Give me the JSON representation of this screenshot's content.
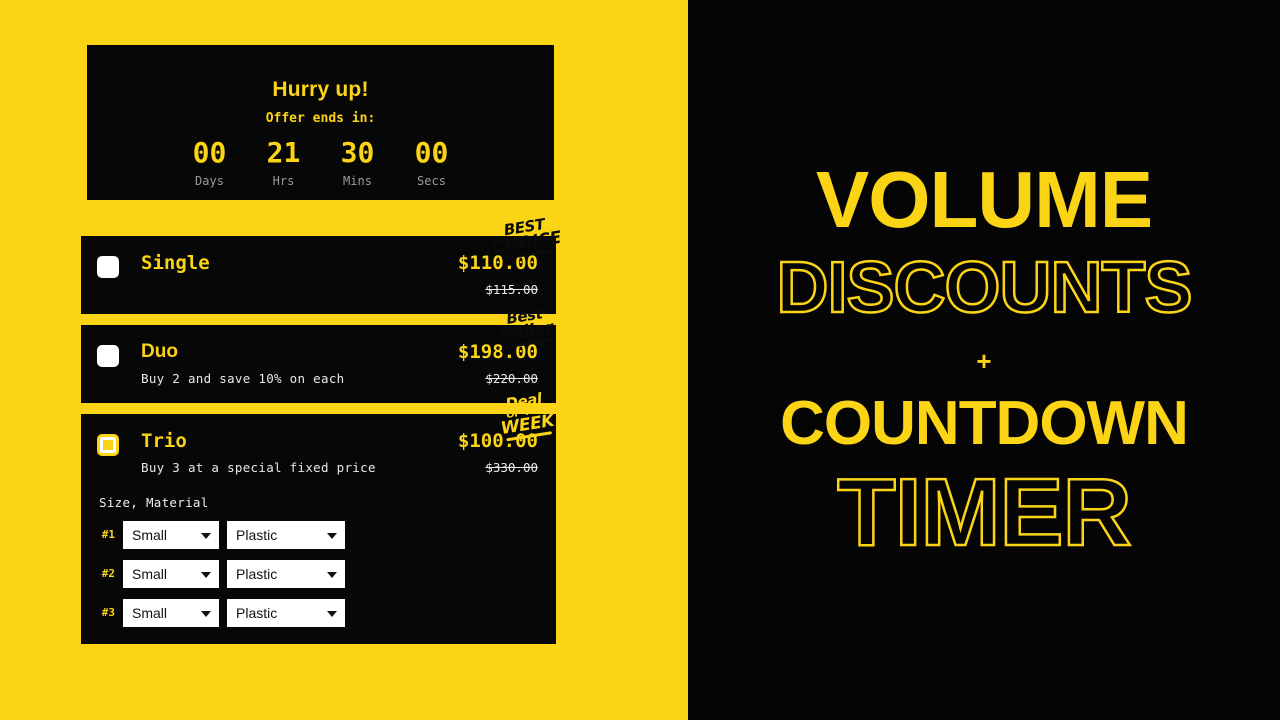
{
  "theme": {
    "yellow": "#FBD415",
    "black": "#070707",
    "white": "#FFFFFF",
    "muted_label": "#9A9A9A"
  },
  "timer": {
    "headline": "Hurry up!",
    "subtitle": "Offer ends in:",
    "units": [
      {
        "value": "00",
        "label": "Days"
      },
      {
        "value": "21",
        "label": "Hrs"
      },
      {
        "value": "30",
        "label": "Mins"
      },
      {
        "value": "00",
        "label": "Secs"
      }
    ]
  },
  "offers": [
    {
      "title": "Single",
      "description": "",
      "price": "$110.00",
      "compare_at_price": "$115.00",
      "selected": false,
      "badge": {
        "line1": "BEST",
        "line2": "CHOICE",
        "line3": "",
        "style": "on-yellow"
      }
    },
    {
      "title": "Duo",
      "description": "Buy 2 and save 10% on each",
      "price": "$198.00",
      "compare_at_price": "$220.00",
      "selected": false,
      "badge": {
        "line1": "Best",
        "line2": "Seller",
        "line3": "",
        "style": "on-yellow"
      }
    },
    {
      "title": "Trio",
      "description": "Buy 3 at a special fixed price",
      "price": "$100.00",
      "compare_at_price": "$330.00",
      "selected": true,
      "badge": {
        "line1": "Deal",
        "line2": "WEEK",
        "line3": "OF THE",
        "style": "on-dark"
      }
    }
  ],
  "variants": {
    "label": "Size, Material",
    "rows": [
      {
        "index": "#1",
        "size": "Small",
        "material": "Plastic"
      },
      {
        "index": "#2",
        "size": "Small",
        "material": "Plastic"
      },
      {
        "index": "#3",
        "size": "Small",
        "material": "Plastic"
      }
    ],
    "size_options": [
      "Small"
    ],
    "material_options": [
      "Plastic"
    ]
  },
  "promo": {
    "line1": "VOLUME",
    "line2": "DISCOUNTS",
    "plus": "+",
    "line3": "COUNTDOWN",
    "line4": "TIMER"
  }
}
